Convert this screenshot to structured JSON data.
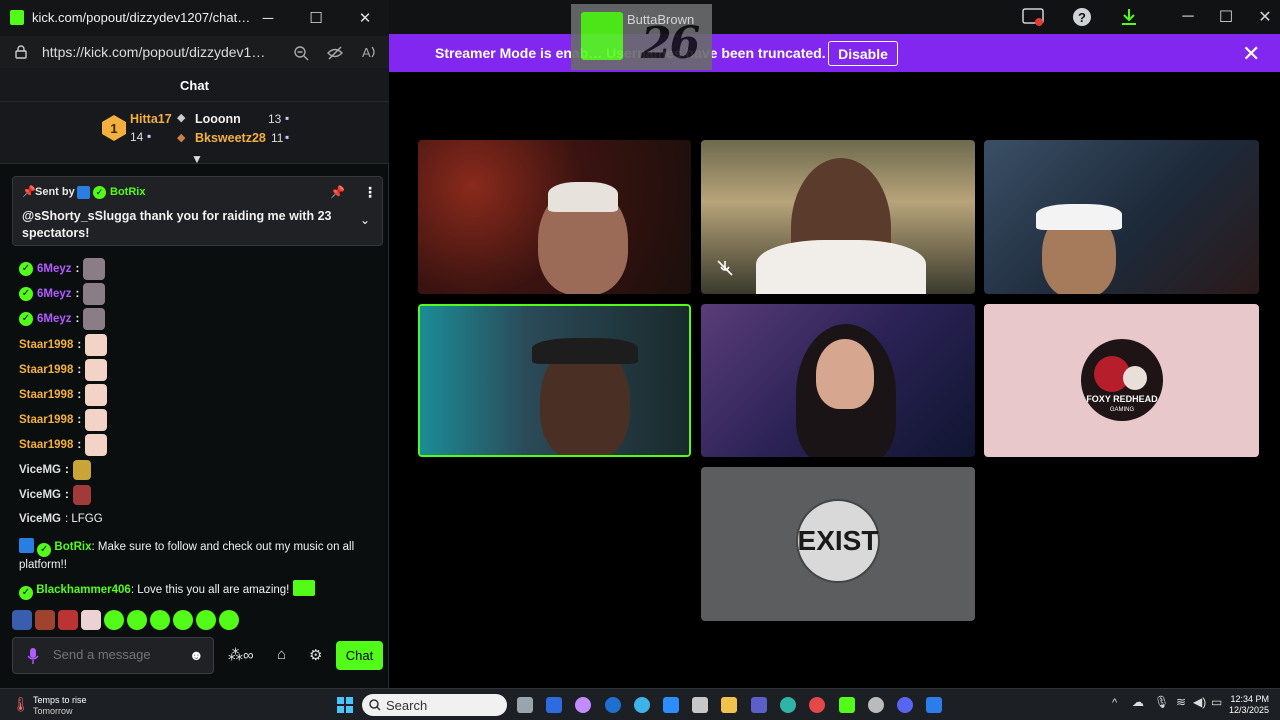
{
  "main_window": {
    "title_partial": "ButtaBrown",
    "kick_overlay_count": "26",
    "banner": {
      "text": "Streamer Mode is enab… Usernames have been truncated.",
      "disable_label": "Disable",
      "close_glyph": "✕"
    },
    "tiles": [
      {
        "name": "tile-1",
        "border": "none"
      },
      {
        "name": "tile-2",
        "border": "none",
        "muted": true
      },
      {
        "name": "tile-3",
        "border": "none"
      },
      {
        "name": "tile-4",
        "border": "#53fc18",
        "active_speaker": true
      },
      {
        "name": "tile-5",
        "border": "none"
      },
      {
        "name": "tile-6",
        "logo_text": "FOXY REDHEAD GAMING",
        "background": "#e8c8cb"
      },
      {
        "name": "tile-7",
        "logo_text": "EXIST",
        "background": "#5b5d5f"
      }
    ]
  },
  "popout": {
    "title": "kick.com/popout/dizzydev1207/chat…",
    "url": "https://kick.com/popout/dizzydev1…",
    "chat_header": "Chat",
    "leaderboard": {
      "first": {
        "rank": "1",
        "name": "Hitta17",
        "count": "14"
      },
      "second": {
        "name": "Looonn",
        "count": "13"
      },
      "third": {
        "name": "Bksweetz28",
        "count": "11"
      }
    },
    "pinned": {
      "sent_by_label": "Sent by",
      "sender": "BotRix",
      "message": "@sShorty_sSlugga thank you for raiding me with 23 spectators!"
    },
    "messages": [
      {
        "user": "6Meyz",
        "text": ":",
        "color": "#b15cff"
      },
      {
        "user": "6Meyz",
        "text": ":",
        "color": "#b15cff"
      },
      {
        "user": "6Meyz",
        "text": ":",
        "color": "#b15cff"
      },
      {
        "user": "Staar1998",
        "text": ":",
        "color": "#f4b03e"
      },
      {
        "user": "Staar1998",
        "text": ":",
        "color": "#f4b03e"
      },
      {
        "user": "Staar1998",
        "text": ":",
        "color": "#f4b03e"
      },
      {
        "user": "Staar1998",
        "text": ":",
        "color": "#f4b03e"
      },
      {
        "user": "Staar1998",
        "text": ":",
        "color": "#f4b03e"
      },
      {
        "user": "ViceMG",
        "text": ":",
        "color": "#e0e0e0"
      },
      {
        "user": "ViceMG",
        "text": ":",
        "color": "#e0e0e0"
      },
      {
        "user": "ViceMG",
        "text": ": LFGG",
        "color": "#e0e0e0"
      }
    ],
    "botrix_msg": {
      "user": "BotRix",
      "text": ": Make sure to follow and check out my music on all platform!!"
    },
    "blackhammer_msg": {
      "user": "Blackhammer406",
      "text": ": Love this you all are amazing!"
    },
    "input_placeholder": "Send a message",
    "send_label": "Chat"
  },
  "taskbar": {
    "weather_line1": "Temps to rise",
    "weather_line2": "Tomorrow",
    "search_label": "Search",
    "time": "12:34 PM",
    "date": "12/3/2025"
  },
  "colors": {
    "kick_green": "#53fc18",
    "banner_purple": "#8127ef"
  }
}
